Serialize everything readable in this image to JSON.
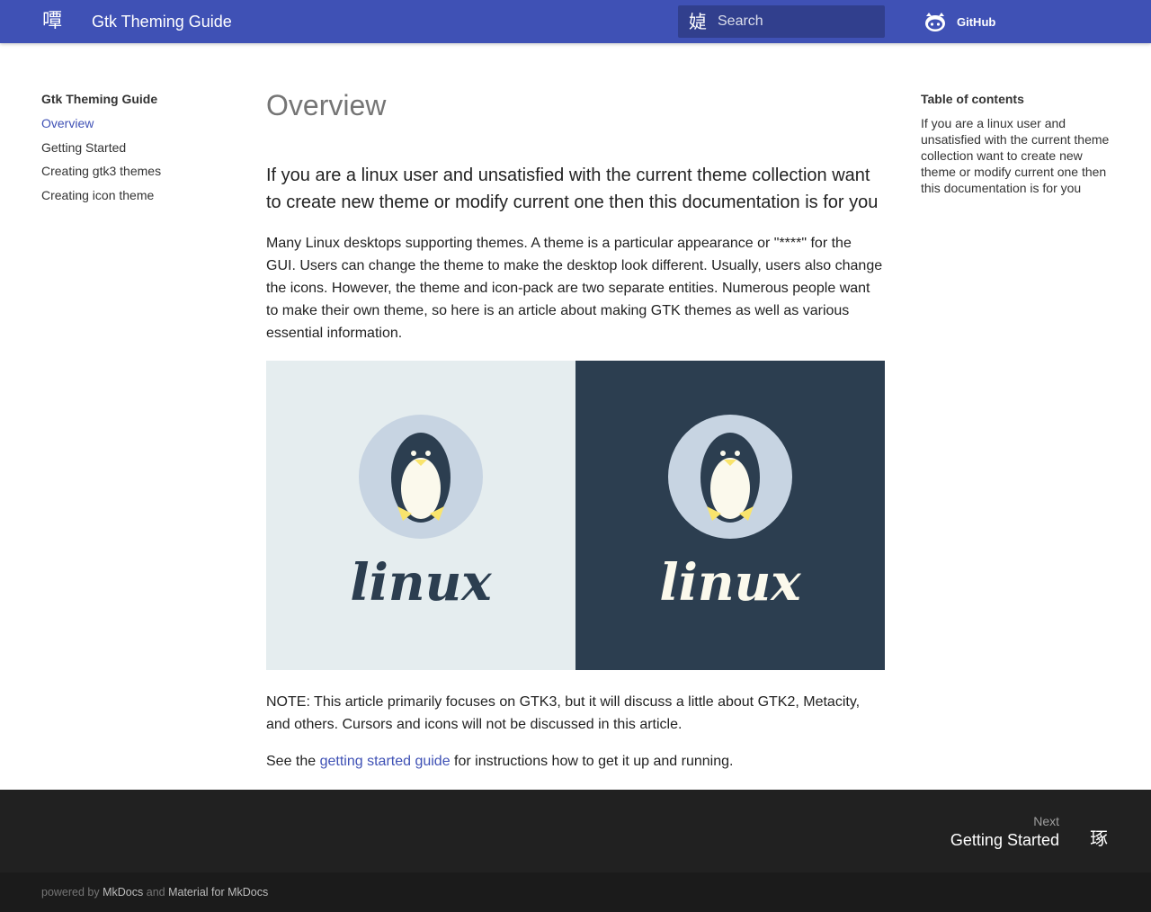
{
  "header": {
    "logo_glyph": "嘾",
    "title": "Gtk Theming Guide",
    "search": {
      "icon_glyph": "媫",
      "placeholder": "Search"
    },
    "repo": {
      "label": "GitHub",
      "icon": "github-icon"
    }
  },
  "nav": {
    "title": "Gtk Theming Guide",
    "items": [
      {
        "label": "Overview",
        "active": true
      },
      {
        "label": "Getting Started"
      },
      {
        "label": "Creating gtk3 themes"
      },
      {
        "label": "Creating icon theme"
      }
    ]
  },
  "toc": {
    "title": "Table of contents",
    "items": [
      {
        "label": "If you are a linux user and unsatisfied with the current theme collection want to create new theme or modify current one then this documentation is for you"
      }
    ]
  },
  "main": {
    "title": "Overview",
    "heading": "If you are a linux user and unsatisfied with the current theme collection want to create new theme or modify current one then this documentation is for you",
    "intro": "Many Linux desktops supporting themes. A theme is a particular appearance or \"****\" for the GUI. Users can change the theme to make the desktop look different. Usually, users also change the icons. However, the theme and icon-pack are two separate entities. Numerous people want to make their own theme, so here is an article about making GTK themes as well as various essential information.",
    "hero": {
      "left_wordmark": "linux",
      "right_wordmark": "linux",
      "colors": {
        "light_bg": "#e5edef",
        "dark_bg": "#2c3e50",
        "circle": "#c7d4e2",
        "body": "#2c3e50",
        "belly": "#fbf9ec",
        "feet": "#f9e46c"
      }
    },
    "note": "NOTE: This article primarily focuses on GTK3, but it will discuss a little about GTK2, Metacity, and others. Cursors and icons will not be discussed in this article.",
    "see": {
      "before": "See the ",
      "link": "getting started guide",
      "after": " for instructions how to get it up and running."
    }
  },
  "footer": {
    "next_direction": "Next",
    "next_title": "Getting Started",
    "next_glyph": "琢",
    "powered_by": "powered by",
    "mkdocs": "MkDocs",
    "and": "and",
    "material": "Material for MkDocs"
  },
  "colors": {
    "primary": "#3f51b5",
    "footer_dark": "#212121",
    "footer_darker": "#1b1b1b"
  }
}
